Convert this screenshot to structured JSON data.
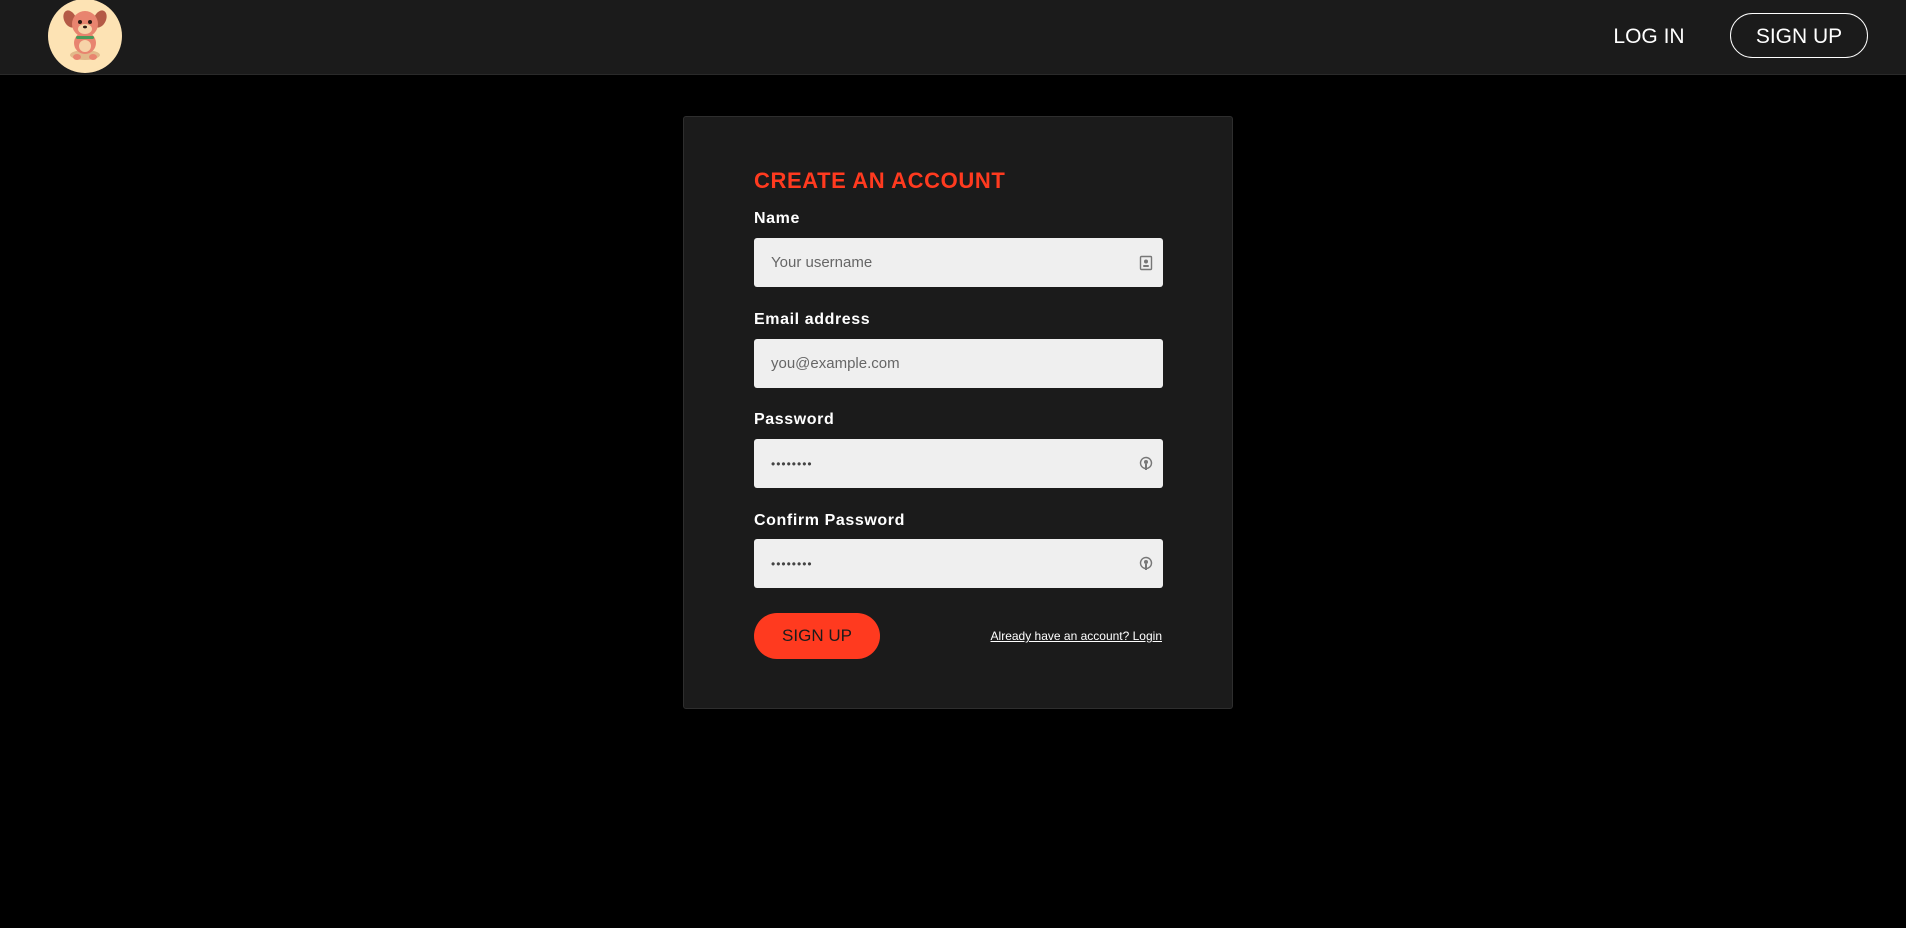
{
  "nav": {
    "logo_icon": "puppy-logo-icon",
    "login_label": "LOG IN",
    "signup_label": "SIGN UP"
  },
  "form": {
    "title": "CREATE AN ACCOUNT",
    "fields": [
      {
        "label": "Name",
        "placeholder": "Your username",
        "value": "",
        "icon": "contact-card-icon"
      },
      {
        "label": "Email address",
        "placeholder": "you@example.com",
        "value": ""
      },
      {
        "label": "Password",
        "placeholder": "",
        "value": "••••••••",
        "icon": "password-key-icon"
      },
      {
        "label": "Confirm Password",
        "placeholder": "",
        "value": "••••••••",
        "icon": "password-key-icon"
      }
    ],
    "submit_label": "SIGN UP",
    "login_link_text": "Already have an account? Login"
  },
  "colors": {
    "accent": "#ff3a1f",
    "page_background": "#000000",
    "surface": "#1b1b1b",
    "input_background": "#efefef",
    "logo_background": "#fde3b4"
  }
}
